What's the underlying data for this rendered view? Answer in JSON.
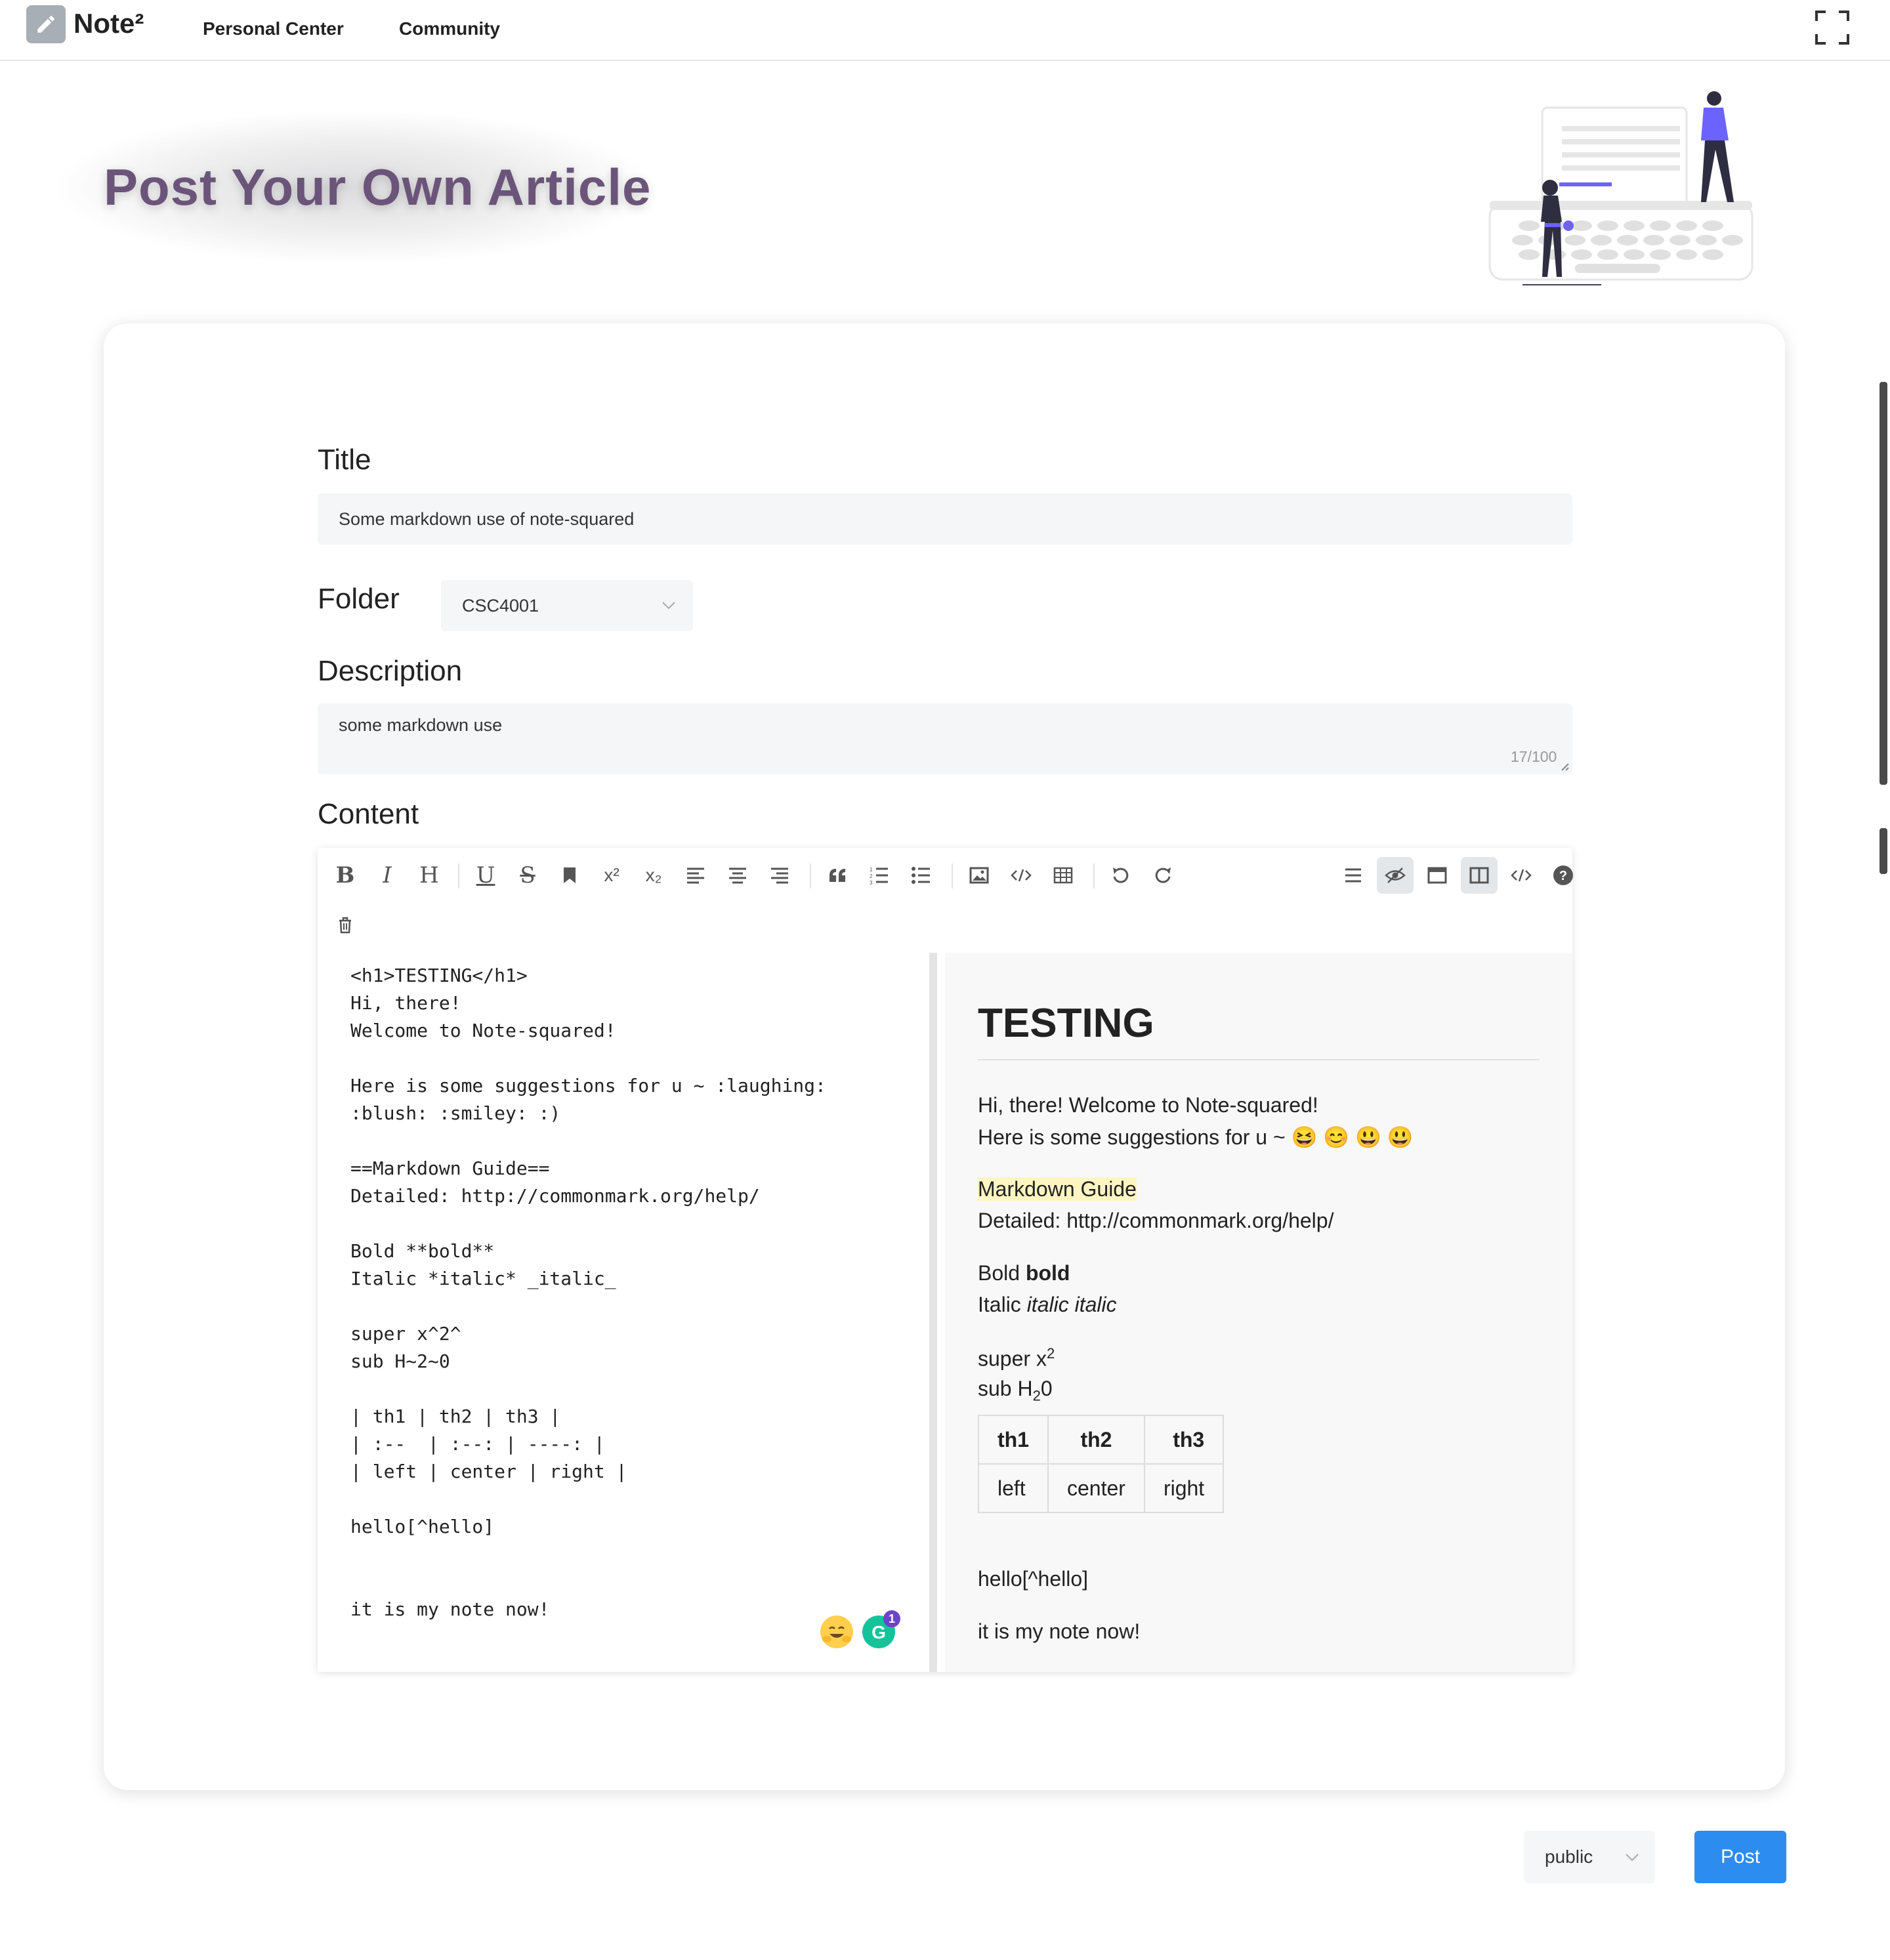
{
  "header": {
    "logo_text": "Note²",
    "nav": [
      "Personal Center",
      "Community"
    ]
  },
  "hero": {
    "title": "Post Your Own Article"
  },
  "form": {
    "title_label": "Title",
    "title_value": "Some markdown use of note-squared",
    "folder_label": "Folder",
    "folder_value": "CSC4001",
    "description_label": "Description",
    "description_value": "some markdown use",
    "description_counter": "17/100",
    "content_label": "Content"
  },
  "editor": {
    "toolbar": {
      "bold": "B",
      "italic": "I",
      "header": "H",
      "underline": "U",
      "strikethrough": "S",
      "superscript": "x²",
      "subscript": "x₂"
    },
    "source_lines": [
      "<h1>TESTING</h1>",
      "Hi, there!",
      "Welcome to Note-squared!",
      "",
      "Here is some suggestions for u ~ :laughing:",
      ":blush: :smiley: :)",
      "",
      "==Markdown Guide==",
      "Detailed: http://commonmark.org/help/",
      "",
      "Bold **bold**",
      "Italic *italic* _italic_",
      "",
      "super x^2^",
      "sub H~2~0",
      "",
      "| th1 | th2 | th3 |",
      "| :--  | :--: | ----: |",
      "| left | center | right |",
      "",
      "hello[^hello]",
      "",
      "",
      "it is my note now!"
    ],
    "preview": {
      "heading": "TESTING",
      "line1": "Hi, there! Welcome to Note-squared!",
      "line2": "Here is some suggestions for u ~ 😆 😊 😃 😃",
      "mark": "Markdown Guide",
      "detailed": "Detailed: http://commonmark.org/help/",
      "bold_prefix": "Bold ",
      "bold_word": "bold",
      "italic_prefix": "Italic ",
      "italic_words": "italic italic",
      "super_prefix": "super x",
      "super_sup": "2",
      "sub_prefix": "sub H",
      "sub_sub": "2",
      "sub_suffix": "0",
      "table_headers": [
        "th1",
        "th2",
        "th3"
      ],
      "table_row": [
        "left",
        "center",
        "right"
      ],
      "footnote": "hello[^hello]",
      "last": "it is my note now!"
    },
    "grammarly_badge": "1"
  },
  "actions": {
    "visibility": "public",
    "post": "Post"
  },
  "colors": {
    "hero_title": "#6b5479",
    "accent": "#2d8cf0",
    "illustration_accent": "#6c63ff",
    "mark_highlight": "#fff5c2"
  }
}
